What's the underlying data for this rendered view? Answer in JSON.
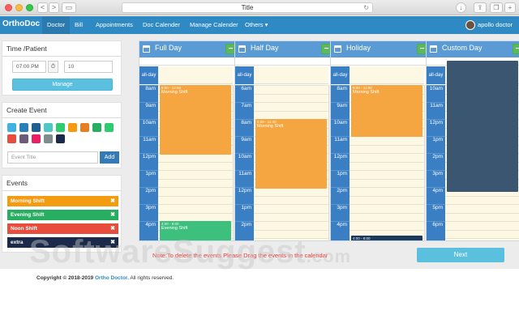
{
  "browser": {
    "title": "Title",
    "back": "<",
    "forward": ">"
  },
  "navbar": {
    "brand": "OrthoDoc",
    "items": [
      {
        "label": "Doctor",
        "active": true
      },
      {
        "label": "Bill"
      },
      {
        "label": "Appointments"
      },
      {
        "label": "Doc Calender"
      },
      {
        "label": "Manage Calender"
      },
      {
        "label": "Others ▾"
      }
    ],
    "user": "apollo doctor"
  },
  "time_panel": {
    "title": "Time /Patient",
    "time_value": "07:00 PM",
    "patients_value": "10",
    "manage_label": "Manage"
  },
  "create_event": {
    "title": "Create Event",
    "colors": [
      "#3fb1e3",
      "#2980b9",
      "#1f5f96",
      "#4fc7c7",
      "#2ecc71",
      "#f39c12",
      "#e67e22",
      "#27ae60",
      "#2ecc71",
      "#e74c3c",
      "#6c5b7b",
      "#e91e63",
      "#7f8c8d",
      "#1b2a4a"
    ],
    "input_placeholder": "Event Title",
    "add_label": "Add"
  },
  "events_panel": {
    "title": "Events",
    "items": [
      {
        "label": "Morning Shift",
        "color": "#f39c12"
      },
      {
        "label": "Evening Shift",
        "color": "#27ae60"
      },
      {
        "label": "Noon Shift",
        "color": "#e74c3c"
      },
      {
        "label": "extra",
        "color": "#1b2a4a"
      }
    ],
    "remove_glyph": "✖"
  },
  "calendars": [
    {
      "name": "Full Day",
      "allday": "all-day",
      "hours": [
        "8am",
        "9am",
        "10am",
        "11am",
        "12pm",
        "1pm",
        "2pm",
        "3pm",
        "4pm"
      ],
      "events": [
        {
          "time": "8:00 - 12:00",
          "name": "Morning Shift",
          "color": "#f5a640"
        },
        {
          "time": "4:00 - 8:00",
          "name": "Evening Shift",
          "color": "#3dbf7d"
        }
      ]
    },
    {
      "name": "Half Day",
      "allday": "all-day",
      "hours": [
        "6am",
        "7am",
        "8am",
        "9am",
        "10am",
        "11am",
        "12pm",
        "1pm",
        "2pm"
      ],
      "events": [
        {
          "time": "8:00 - 11:30",
          "name": "Morning Shift",
          "color": "#f5a640"
        }
      ]
    },
    {
      "name": "Holiday",
      "allday": "all-day",
      "hours": [
        "8am",
        "9am",
        "10am",
        "11am",
        "12pm",
        "1pm",
        "2pm",
        "3pm",
        "4pm"
      ],
      "events": [
        {
          "time": "8:00 - 11:00",
          "name": "Morning Shift",
          "color": "#f5a640"
        },
        {
          "time": "4:00 - 8:00",
          "name": "",
          "color": "#1b3a5c"
        }
      ]
    },
    {
      "name": "Custom Day",
      "allday": "all-day",
      "hours": [
        "10am",
        "11am",
        "12pm",
        "1pm",
        "2pm",
        "3pm",
        "4pm",
        "5pm",
        "6pm"
      ],
      "events": [
        {
          "time": "",
          "name": "",
          "color": "#3b5671"
        }
      ]
    }
  ],
  "note": "Note:To delete the events Please Drag the events in the calendar",
  "next_label": "Next",
  "footer": {
    "copyright": "Copyright © 2018-2019",
    "brand": "Ortho Doctor.",
    "rights": "All rights reserved."
  },
  "watermark": {
    "main": "SoftwareSuggest",
    "tld": ".com"
  }
}
